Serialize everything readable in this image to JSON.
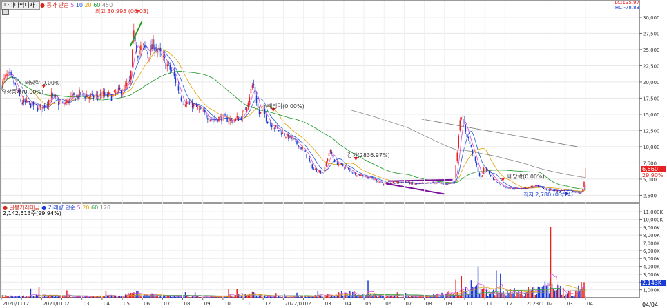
{
  "header": {
    "stock_name": "다이나믹디자인",
    "price_label": "종가",
    "ma_label": "단순",
    "ma_periods": [
      "5",
      "10",
      "20",
      "60",
      "450"
    ],
    "lc_label": "LC:135.97",
    "hc_label": "HC:-78.83"
  },
  "volume_header": {
    "title": "일봉거래대금",
    "ma_label": "거래량 단순",
    "ma_periods": [
      "5",
      "20",
      "60",
      "120"
    ],
    "current_volume": "2,142,513주(99.94%)"
  },
  "colors": {
    "up": "#e8211c",
    "down": "#1a3cd6",
    "ma5": "#d94bd0",
    "ma10": "#1f5ad9",
    "ma20": "#e0a100",
    "ma60": "#2b9e3a",
    "ma450": "#888888",
    "trend_purple": "#7a0f9a",
    "trend_green": "#1e9e1e",
    "trend_gray": "#777777",
    "price_tag": "#e62222"
  },
  "annotations": {
    "high": "최고 30,995 (06/03)",
    "low": "최저 2,780 (03/14)",
    "dividend1": "배당락(0.00%)",
    "dividend2": "배당락(0.00%)",
    "dividend3": "배당락(0.00%)",
    "capital_increase": "유상증자(0.00%)",
    "capital_reduction": "감자(2836.97%)"
  },
  "price_tags": {
    "current": "6,560",
    "change": "29.90%"
  },
  "volume_tags": {
    "current": "2,143K"
  },
  "chart_data": [
    {
      "type": "candlestick",
      "title": "다이나믹디자인",
      "y_ticks": [
        "2,500",
        "5,000",
        "7,500",
        "10,000",
        "12,500",
        "15,000",
        "17,500",
        "20,000",
        "22,500",
        "25,000",
        "27,500",
        "30,000"
      ],
      "y_tick_values": [
        2500,
        5000,
        7500,
        10000,
        12500,
        15000,
        17500,
        20000,
        22500,
        25000,
        27500,
        30000
      ],
      "ylim": [
        1800,
        31800
      ],
      "x_ticks": [
        "2020/11",
        "12",
        "2021/01",
        "02",
        "03",
        "04",
        "05",
        "06",
        "07",
        "08",
        "09",
        "10",
        "11",
        "12",
        "2022/01",
        "02",
        "03",
        "04",
        "05",
        "06",
        "07",
        "08",
        "09",
        "10",
        "11",
        "12",
        "2023/01",
        "02",
        "03",
        "04"
      ],
      "x_tick_pos": [
        0,
        1,
        2,
        3,
        4,
        5,
        6,
        7,
        8,
        9,
        10,
        11,
        12,
        13,
        14,
        15,
        16,
        17,
        18,
        19,
        20,
        21,
        22,
        23,
        24,
        25,
        26,
        27,
        28,
        29
      ],
      "x_axis_end_label": "04/04",
      "price_path_x": [
        0,
        0.3,
        0.6,
        1.0,
        1.5,
        2.0,
        2.5,
        3.0,
        3.5,
        4.0,
        4.5,
        5.0,
        5.5,
        6.0,
        6.4,
        6.6,
        6.75,
        7.0,
        7.3,
        7.6,
        8.0,
        8.5,
        9.0,
        9.5,
        10.0,
        10.5,
        11.0,
        11.5,
        12.0,
        12.5,
        12.8,
        13.0,
        13.2,
        13.5,
        14.0,
        14.5,
        15.0,
        15.5,
        16.0,
        16.3,
        16.6,
        17.0,
        17.3,
        17.6,
        18.0,
        18.5,
        19.0,
        19.5,
        20.0,
        20.5,
        21.0,
        21.5,
        22.0,
        22.5,
        22.8,
        23.0,
        23.2,
        23.5,
        23.8,
        24.0,
        24.3,
        24.6,
        25.0,
        25.5,
        26.0,
        26.5,
        27.0,
        27.5,
        28.0,
        28.4,
        28.7,
        28.9,
        29.0
      ],
      "price_path": [
        19500,
        21000,
        20000,
        16800,
        16500,
        15800,
        17800,
        16300,
        17500,
        18200,
        17500,
        18000,
        17800,
        18800,
        19800,
        28000,
        24500,
        25500,
        24500,
        25800,
        23500,
        21500,
        17000,
        16500,
        15200,
        14200,
        14500,
        14000,
        14800,
        19800,
        15000,
        15500,
        14200,
        13200,
        12000,
        11000,
        9500,
        6500,
        6000,
        9500,
        7500,
        7000,
        6300,
        5800,
        5500,
        5000,
        4200,
        4400,
        4600,
        4200,
        4300,
        4500,
        4200,
        4600,
        15500,
        13000,
        11000,
        8000,
        5000,
        7000,
        5500,
        4500,
        3800,
        3500,
        3600,
        4000,
        3400,
        3200,
        3300,
        3100,
        2800,
        3500,
        6560
      ],
      "ma_periods": [
        5,
        10,
        20,
        60,
        450
      ],
      "trendlines": [
        {
          "name": "green",
          "from": [
            6.4,
            25500
          ],
          "to": [
            7.0,
            29500
          ]
        },
        {
          "name": "purple-flat",
          "from": [
            19.2,
            4700
          ],
          "to": [
            22.4,
            4900
          ]
        },
        {
          "name": "purple-down",
          "from": [
            19.1,
            4300
          ],
          "to": [
            22.0,
            2700
          ]
        },
        {
          "name": "gray-long",
          "from": [
            20.8,
            14300
          ],
          "to": [
            28.6,
            10000
          ]
        }
      ]
    },
    {
      "type": "bar",
      "title": "일봉거래대금",
      "y_ticks": [
        "1,000K",
        "2,000K",
        "3,000K",
        "4,000K",
        "5,000K",
        "6,000K",
        "7,000K",
        "8,000K",
        "9,000K",
        "10,000K",
        "11,000K"
      ],
      "y_tick_values": [
        1000,
        2000,
        3000,
        4000,
        5000,
        6000,
        7000,
        8000,
        9000,
        10000,
        11000
      ],
      "ylim": [
        0,
        11800
      ],
      "volume_path_x": [
        0,
        1,
        2,
        3,
        4,
        5,
        6,
        6.8,
        7.0,
        8,
        9,
        10,
        11,
        12,
        12.5,
        13,
        14,
        15,
        16,
        17.3,
        17.5,
        18.3,
        19,
        20,
        21,
        22.3,
        23,
        23.3,
        23.8,
        24.3,
        25,
        25.3,
        26,
        26.5,
        27.2,
        27.5,
        28.0,
        28.5,
        28.9,
        29.0
      ],
      "volume_peaks": [
        1200,
        900,
        1500,
        1200,
        800,
        1000,
        1200,
        3700,
        2600,
        1300,
        900,
        700,
        800,
        2200,
        2800,
        900,
        600,
        900,
        1500,
        3800,
        2800,
        2100,
        1200,
        900,
        700,
        2900,
        3400,
        10200,
        4800,
        3900,
        3200,
        4500,
        3900,
        5800,
        11000,
        6800,
        3500,
        2600,
        11000,
        2143
      ]
    }
  ]
}
